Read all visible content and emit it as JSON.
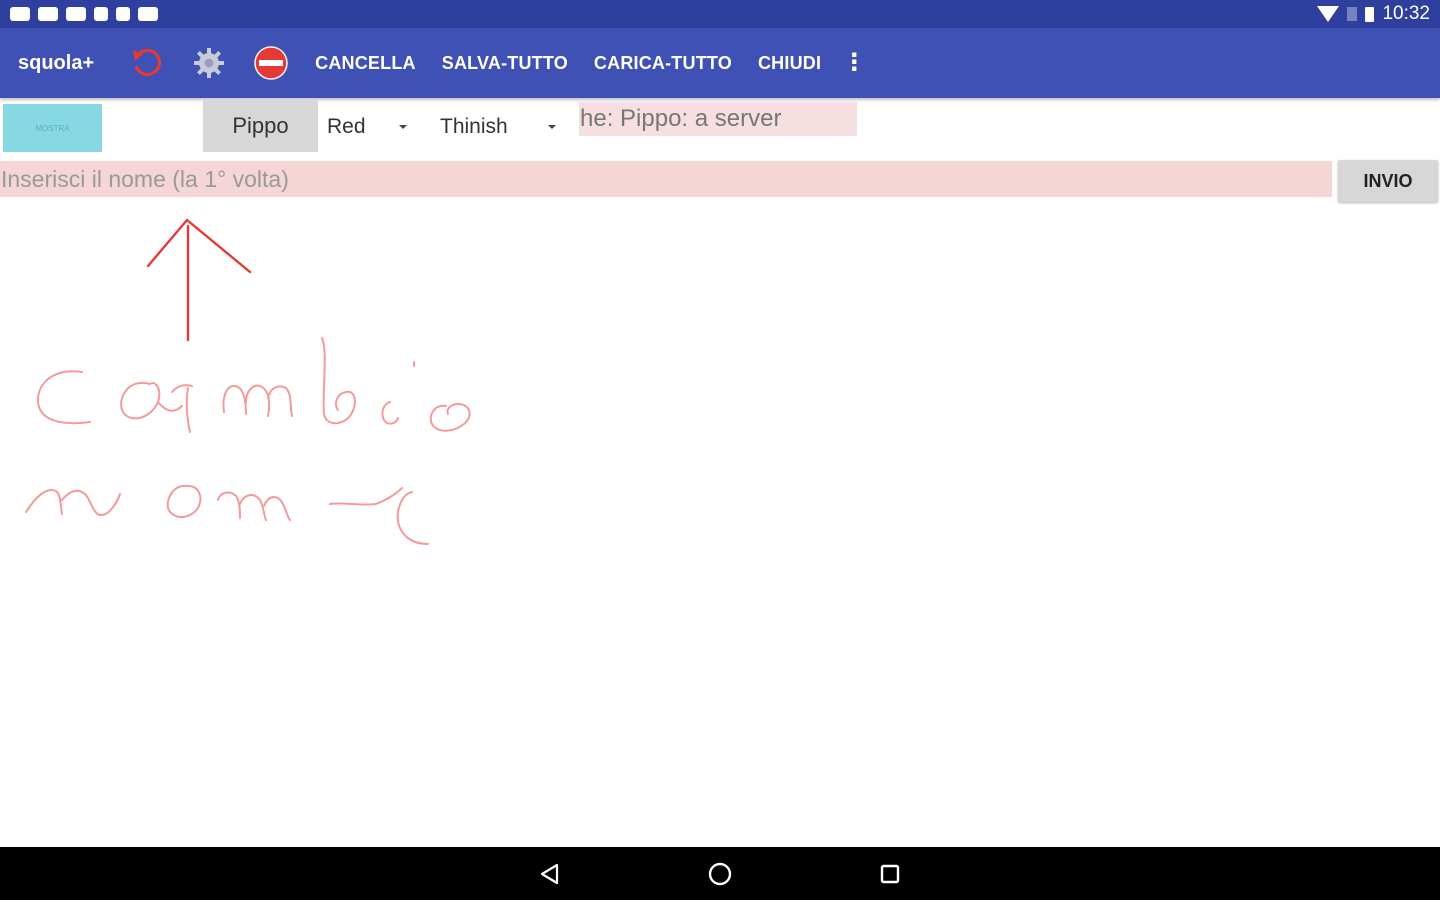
{
  "status_bar": {
    "time": "10:32",
    "notification_icons": [
      "message-icon",
      "message-icon",
      "image-icon",
      "download-icon",
      "sd-card-icon",
      "image-icon"
    ]
  },
  "toolbar": {
    "app_title": "squola+",
    "icons": [
      "undo-icon",
      "settings-icon",
      "no-entry-icon",
      "more-vert-icon"
    ],
    "buttons": [
      "CANCELLA",
      "SALVA-TUTTO",
      "CARICA-TUTTO",
      "CHIUDI"
    ]
  },
  "controls": {
    "mostra_label": "MOSTRA",
    "user_name": "Pippo",
    "color_select": "Red",
    "width_select": "Thinish",
    "status_text": "he: Pippo: a server"
  },
  "name_input": {
    "placeholder": "Inserisci il nome (la 1° volta)",
    "value": ""
  },
  "send_button": "INVIO",
  "colors": {
    "status_bar": "#2f3f9e",
    "toolbar": "#3f51b5",
    "ink": "#e53935",
    "input_bg": "#f4d6d7"
  },
  "navigation": [
    "back-icon",
    "home-icon",
    "recents-icon"
  ]
}
